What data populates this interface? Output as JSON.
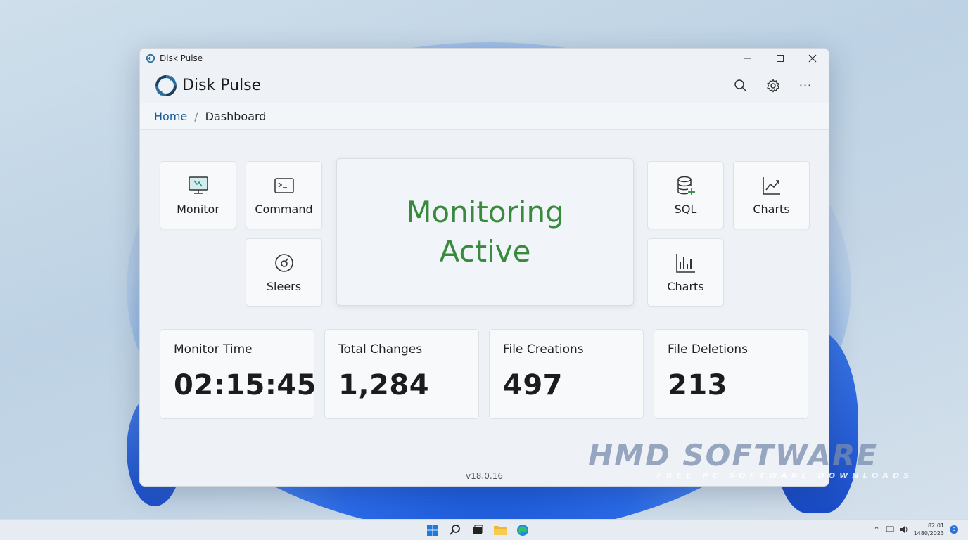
{
  "window": {
    "title": "Disk Pulse",
    "minimize_glyph": "—",
    "maximize_glyph": "☐",
    "close_glyph": "✕"
  },
  "header": {
    "app_name": "Disk Pulse",
    "icons": [
      "search-icon",
      "gear-icon",
      "more-icon"
    ],
    "more_glyph": "···"
  },
  "breadcrumb": {
    "home": "Home",
    "separator": "/",
    "current": "Dashboard"
  },
  "tiles": {
    "monitor": "Monitor",
    "command": "Command",
    "sleers": "Sleers",
    "sql": "SQL",
    "charts_line": "Charts",
    "charts_bar": "Charts"
  },
  "status": {
    "text": "Monitoring Active",
    "color": "#3a8a3e"
  },
  "stats": [
    {
      "label": "Monitor Time",
      "value": "02:15:45"
    },
    {
      "label": "Total Changes",
      "value": "1,284"
    },
    {
      "label": "File Creations",
      "value": "497"
    },
    {
      "label": "File Deletions",
      "value": "213"
    }
  ],
  "footer": {
    "version": "v18.0.16"
  },
  "watermark": {
    "main": "HMD SOFTWARE",
    "sub": "FREE PC SOFTWARE DOWNLOADS"
  },
  "taskbar": {
    "icons": [
      "windows-start-icon",
      "search-icon",
      "task-view-icon",
      "file-explorer-icon",
      "edge-icon"
    ],
    "time": "82:01",
    "date": "1480/2023",
    "notification_count": "0"
  },
  "colors": {
    "accent": "#1a5a9a",
    "status_green": "#3a8a3e"
  }
}
